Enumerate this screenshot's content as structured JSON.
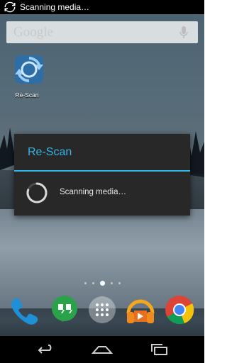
{
  "status_bar": {
    "notification_text": "Scanning media…",
    "icon": "sync-icon"
  },
  "search": {
    "placeholder": "Google",
    "mic_icon": "mic-icon"
  },
  "home_shortcuts": [
    {
      "label": "Re-Scan",
      "icon": "refresh-icon"
    }
  ],
  "dialog": {
    "title": "Re-Scan",
    "message": "Scanning media…",
    "accent_color": "#33b5e5"
  },
  "pager": {
    "pages": 5,
    "current": 2
  },
  "dock": [
    {
      "app": "phone",
      "icon": "phone-icon"
    },
    {
      "app": "hangouts",
      "icon": "hangouts-icon"
    },
    {
      "app": "apps",
      "icon": "app-drawer-icon"
    },
    {
      "app": "play-music",
      "icon": "headphones-icon"
    },
    {
      "app": "chrome",
      "icon": "chrome-icon"
    }
  ],
  "nav": {
    "buttons": [
      "back",
      "home",
      "recents"
    ]
  }
}
